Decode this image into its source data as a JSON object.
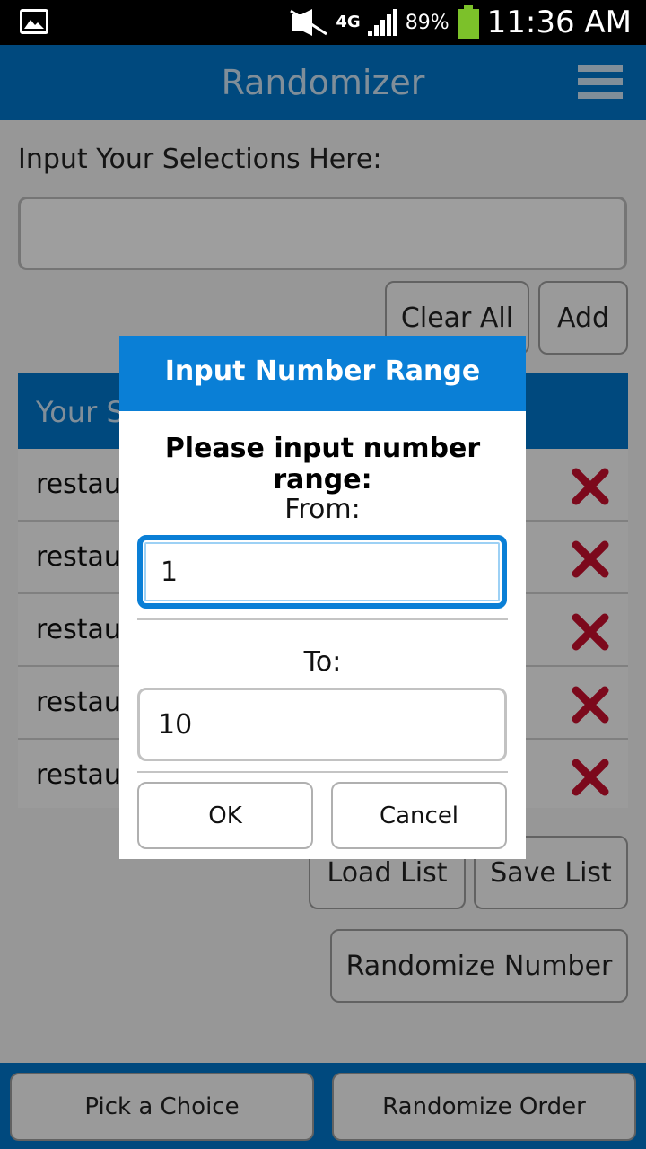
{
  "status_bar": {
    "network": "4G",
    "battery_percent": "89%",
    "time": "11:36 AM",
    "icons": [
      "image-notification-icon",
      "mute-icon",
      "signal-icon",
      "battery-icon"
    ]
  },
  "app_bar": {
    "title": "Randomizer",
    "menu_icon": "hamburger-menu-icon"
  },
  "main": {
    "input_label": "Input Your Selections Here:",
    "input_value": "",
    "clear_all_label": "Clear All",
    "add_label": "Add",
    "list_header": "Your S",
    "list_items": [
      "restau",
      "restau",
      "restau",
      "restau",
      "restau"
    ],
    "load_list_label": "Load List",
    "save_list_label": "Save List",
    "randomize_number_label": "Randomize Number"
  },
  "bottom_bar": {
    "pick_choice_label": "Pick a Choice",
    "randomize_order_label": "Randomize Order"
  },
  "dialog": {
    "title": "Input Number Range",
    "prompt": "Please input number range:",
    "from_label": "From:",
    "from_value": "1",
    "to_label": "To:",
    "to_value": "10",
    "ok_label": "OK",
    "cancel_label": "Cancel"
  },
  "colors": {
    "accent": "#0077cc",
    "dialog_header": "#0a7fd6",
    "delete_icon": "#c8102e"
  }
}
